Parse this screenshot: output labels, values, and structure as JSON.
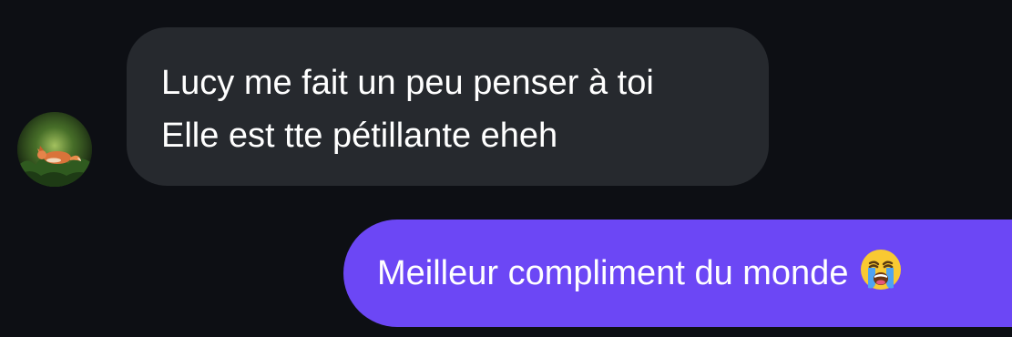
{
  "conversation": {
    "received_message": {
      "lines": [
        "Lucy me fait un peu penser à toi",
        "Elle est tte pétillante eheh"
      ],
      "avatar_icon": "fox-avatar-icon"
    },
    "sent_message": {
      "text": "Meilleur compliment du monde",
      "emoji_icon": "loudly-crying-face-emoji"
    }
  },
  "colors": {
    "background": "#0d0f14",
    "received_bubble": "#26292e",
    "sent_bubble": "#6c47f5",
    "text": "#ffffff"
  }
}
